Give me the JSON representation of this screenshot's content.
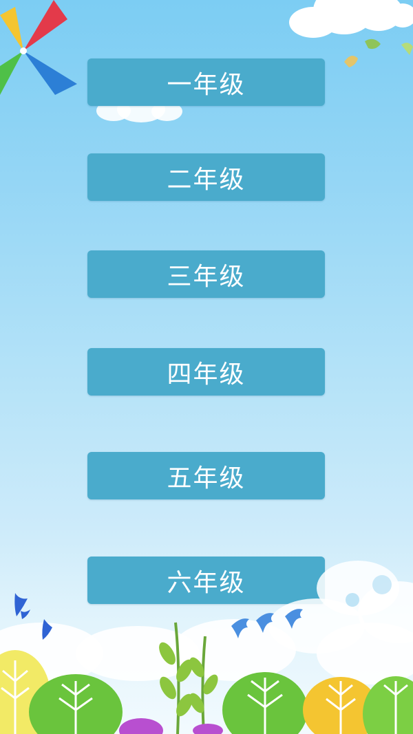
{
  "grades": [
    {
      "label": "一年级"
    },
    {
      "label": "二年级"
    },
    {
      "label": "三年级"
    },
    {
      "label": "四年级"
    },
    {
      "label": "五年级"
    },
    {
      "label": "六年级"
    }
  ],
  "colors": {
    "button": "#4aabcc",
    "button_text": "#ffffff",
    "sky_top": "#7ccdf3",
    "sky_bottom": "#f2fafe"
  },
  "icons": {
    "pinwheel": "pinwheel-icon",
    "birds": "bird-icon",
    "trees": "tree-icon",
    "clouds": "cloud-icon"
  }
}
